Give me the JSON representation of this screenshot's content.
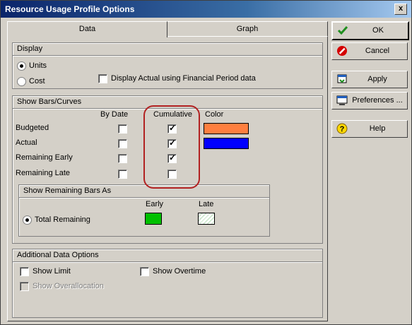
{
  "window": {
    "title": "Resource Usage Profile Options",
    "close_glyph": "x"
  },
  "tabs": [
    {
      "label": "Data",
      "active": true
    },
    {
      "label": "Graph",
      "active": false
    }
  ],
  "display": {
    "title": "Display",
    "units_label": "Units",
    "units_selected": true,
    "cost_label": "Cost",
    "cost_selected": false,
    "financial_label": "Display Actual using Financial Period data",
    "financial_checked": false
  },
  "bars": {
    "title": "Show Bars/Curves",
    "col_bydate": "By Date",
    "col_cumulative": "Cumulative",
    "col_color": "Color",
    "rows": [
      {
        "label": "Budgeted",
        "by_date": false,
        "cumulative": true,
        "color": "#ff7f3f"
      },
      {
        "label": "Actual",
        "by_date": false,
        "cumulative": true,
        "color": "#0000ff"
      },
      {
        "label": "Remaining Early",
        "by_date": false,
        "cumulative": true
      },
      {
        "label": "Remaining Late",
        "by_date": false,
        "cumulative": false
      }
    ]
  },
  "remaining": {
    "title": "Show Remaining Bars As",
    "early_label": "Early",
    "late_label": "Late",
    "total_label": "Total Remaining",
    "total_selected": true,
    "early_color": "#00c000",
    "late_color": "#ffffff"
  },
  "additional": {
    "title": "Additional Data Options",
    "limit_label": "Show Limit",
    "limit_checked": false,
    "overtime_label": "Show Overtime",
    "overtime_checked": false,
    "overallocation_label": "Show Overallocation",
    "overallocation_checked": false
  },
  "buttons": {
    "ok": {
      "label": "OK",
      "icon": "checkmark-icon"
    },
    "cancel": {
      "label": "Cancel",
      "icon": "cancel-icon"
    },
    "apply": {
      "label": "Apply",
      "icon": "apply-icon"
    },
    "preferences": {
      "label": "Preferences ...",
      "icon": "preferences-icon"
    },
    "help": {
      "label": "Help",
      "icon": "help-icon"
    }
  }
}
